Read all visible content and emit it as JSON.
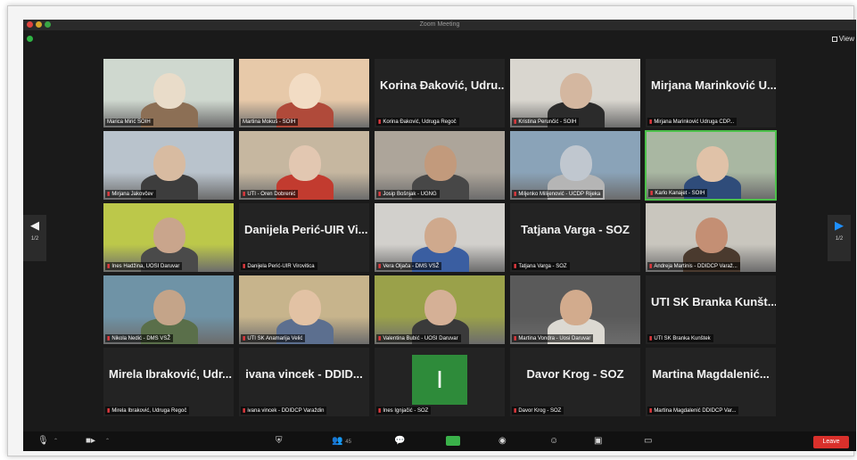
{
  "window": {
    "title": "Zoom Meeting",
    "view_label": "View"
  },
  "pagination": {
    "left_page": "1/2",
    "right_page": "1/2"
  },
  "participants": [
    {
      "label": "Marica Mirić SOIH",
      "video": true
    },
    {
      "label": "Martina Mokuš - SOIH",
      "video": true
    },
    {
      "label": "Korina Đaković, Udruga Regoč",
      "display_name": "Korina Đaković, Udru...",
      "video": false,
      "muted": true
    },
    {
      "label": "Kristina Perunčić - SOIH",
      "video": true,
      "muted": true
    },
    {
      "label": "Mirjana Marinković Udruga CDP...",
      "display_name": "Mirjana Marinković U...",
      "video": false,
      "muted": true
    },
    {
      "label": "Mirjana Jakovčev",
      "video": true,
      "muted": true
    },
    {
      "label": "UTI - Oren Dobrenić",
      "video": true,
      "muted": true
    },
    {
      "label": "Josip Bošnjak - UGNG",
      "video": true,
      "muted": true
    },
    {
      "label": "Miljenko Milijenović - UCDP Rijeka",
      "video": true,
      "muted": true
    },
    {
      "label": "Karlo Kanajet - SOIH",
      "video": true,
      "muted": true,
      "active": true
    },
    {
      "label": "Ines Hadžina, UOSI Daruvar",
      "video": true,
      "muted": true
    },
    {
      "label": "Danijela Perić-UIR Virovitica",
      "display_name": "Danijela Perić-UIR Vi...",
      "video": false,
      "muted": true
    },
    {
      "label": "Vera Oljača - DMS VSŽ",
      "video": true,
      "muted": true
    },
    {
      "label": "Tatjana Varga - SOZ",
      "display_name": "Tatjana Varga - SOZ",
      "video": false,
      "muted": true
    },
    {
      "label": "Andreja Martinis - DDIDCP Varaž...",
      "video": true,
      "muted": true
    },
    {
      "label": "Nikola Nedić - DMS VSŽ",
      "video": true,
      "muted": true
    },
    {
      "label": "UTI SK Anamarija Velić",
      "video": true,
      "muted": true
    },
    {
      "label": "Valentina Bubić - UOSI Daruvar",
      "video": true,
      "muted": true
    },
    {
      "label": "Martina Vondra - Uosi Daruvar",
      "video": true,
      "muted": true
    },
    {
      "label": "UTI SK Branka Kunštek",
      "display_name": "UTI SK Branka Kunšt...",
      "video": false,
      "muted": true
    },
    {
      "label": "Mirela Ibraković, Udruga Regoč",
      "display_name": "Mirela Ibraković, Udr...",
      "video": false,
      "muted": true
    },
    {
      "label": "ivana vincek - DDIDCP Varaždin",
      "display_name": "ivana vincek - DDID...",
      "video": false,
      "muted": true
    },
    {
      "label": "Ines Ignjačić - SOZ",
      "avatar_letter": "I",
      "video": false,
      "muted": true
    },
    {
      "label": "Davor Krog - SOZ",
      "display_name": "Davor Krog - SOZ",
      "video": false,
      "muted": true
    },
    {
      "label": "Martina Magdalenić DDIDCP Var...",
      "display_name": "Martina Magdalenić...",
      "video": false,
      "muted": true
    }
  ],
  "toolbar": {
    "participants_count": "45",
    "leave_label": "Leave"
  },
  "colors": {
    "active_speaker": "#4cc04a",
    "muted_mic": "#e0393e",
    "share": "#3ab14a",
    "leave": "#d9302b"
  }
}
